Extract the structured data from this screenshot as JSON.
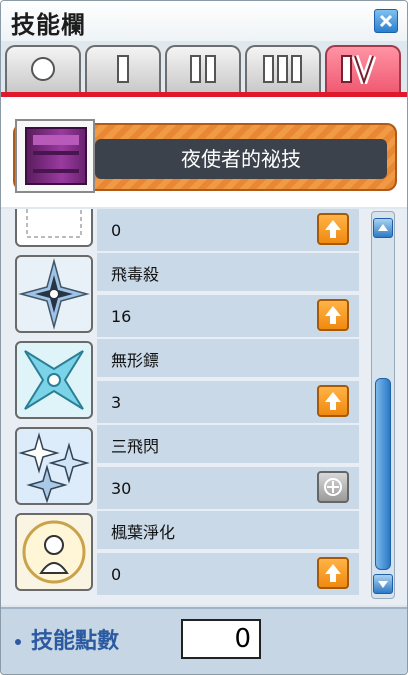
{
  "window": {
    "title": "技能欄",
    "close_label": "close"
  },
  "tabs": [
    {
      "label": "0"
    },
    {
      "label": "I"
    },
    {
      "label": "II"
    },
    {
      "label": "III"
    },
    {
      "label": "IV",
      "active": true
    }
  ],
  "job": {
    "name": "夜使者的祕技"
  },
  "skills": [
    {
      "name": "",
      "level": "0",
      "can_upgrade": true
    },
    {
      "name": "飛毒殺",
      "level": "16",
      "can_upgrade": true
    },
    {
      "name": "無形鏢",
      "level": "3",
      "can_upgrade": true
    },
    {
      "name": "三飛閃",
      "level": "30",
      "can_upgrade": false
    },
    {
      "name": "楓葉淨化",
      "level": "0",
      "can_upgrade": true
    }
  ],
  "footer": {
    "label": "技能點數",
    "points": "0"
  },
  "colors": {
    "accent_red": "#e0182c",
    "upgrade_orange": "#f08a10",
    "job_orange": "#e88734"
  }
}
